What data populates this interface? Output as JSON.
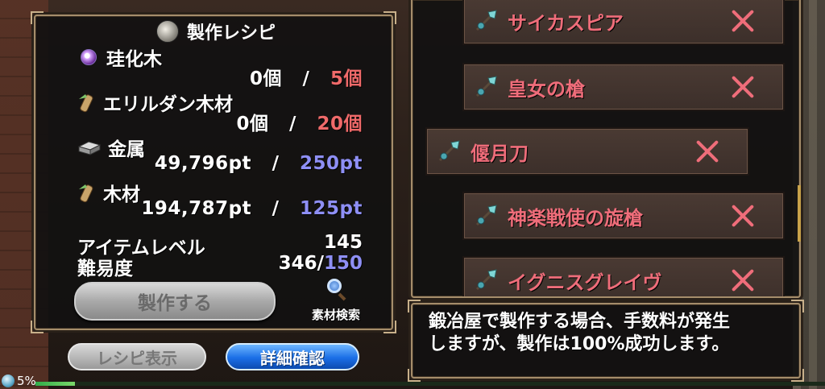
{
  "title": "製作レシピ",
  "materials": [
    {
      "name": "珪化木",
      "icon": "orb-icon",
      "have": "0個",
      "sep": "/",
      "need": "5個",
      "need_color": "red"
    },
    {
      "name": "エリルダン木材",
      "icon": "wood-icon",
      "have": "0個",
      "sep": "/",
      "need": "20個",
      "need_color": "red"
    },
    {
      "name": "金属",
      "icon": "metal-ingot-icon",
      "have": "49,796pt",
      "sep": "/",
      "need": "250pt",
      "need_color": "blue"
    },
    {
      "name": "木材",
      "icon": "wood-icon",
      "have": "194,787pt",
      "sep": "/",
      "need": "125pt",
      "need_color": "blue"
    }
  ],
  "stats": {
    "item_level_label": "アイテムレベル",
    "item_level_value": "145",
    "difficulty_label": "難易度",
    "difficulty_value": "346/",
    "difficulty_max": "150"
  },
  "craft_button": "製作する",
  "material_search": "素材検索",
  "recipe_display_button": "レシピ表示",
  "details_button": "詳細確認",
  "status": {
    "percent": "5%",
    "progress": 0.05
  },
  "items": [
    {
      "name": "サイカスピア",
      "icon": "spear-icon",
      "selected": false
    },
    {
      "name": "皇女の槍",
      "icon": "spear-icon",
      "selected": false
    },
    {
      "name": "偃月刀",
      "icon": "spear-icon",
      "selected": true
    },
    {
      "name": "神楽戦使の旋槍",
      "icon": "spear-icon",
      "selected": false
    },
    {
      "name": "イグニスグレイヴ",
      "icon": "spear-icon",
      "selected": false
    }
  ],
  "info_text_line1": "鍛冶屋で製作する場合、手数料が発生",
  "info_text_line2": "しますが、製作は100%成功します。",
  "colors": {
    "req_red": "#f06a6a",
    "req_blue": "#8e8ff5",
    "item_red": "#ef6d7a",
    "details_blue": "#1a6ee6"
  }
}
